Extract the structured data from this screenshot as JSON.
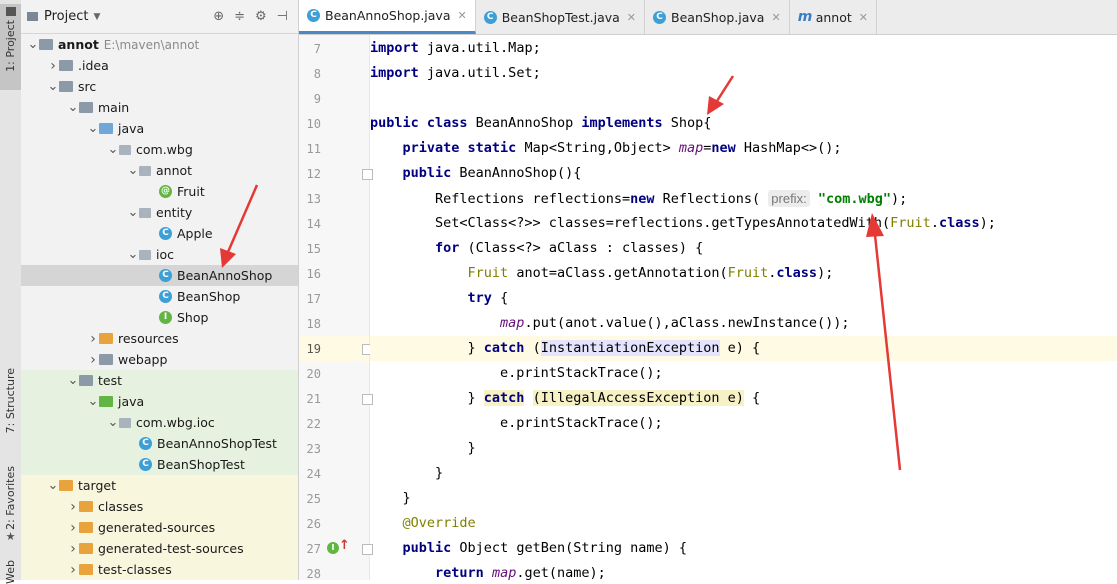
{
  "sidebar_strip": {
    "project_tab": "1: Project",
    "structure_tab": "7: Structure",
    "favorites_tab": "2: Favorites",
    "web_tab": "Web"
  },
  "project_panel": {
    "title": "Project",
    "tree": [
      {
        "label": "annot",
        "note": "E:\\maven\\annot",
        "icon": "module-folder",
        "depth": 0,
        "expanded": true
      },
      {
        "label": ".idea",
        "icon": "folder",
        "depth": 1,
        "expanded": false
      },
      {
        "label": "src",
        "icon": "folder",
        "depth": 1,
        "expanded": true
      },
      {
        "label": "main",
        "icon": "folder",
        "depth": 2,
        "expanded": true
      },
      {
        "label": "java",
        "icon": "source-folder",
        "depth": 3,
        "expanded": true
      },
      {
        "label": "com.wbg",
        "icon": "package",
        "depth": 4,
        "expanded": true
      },
      {
        "label": "annot",
        "icon": "package",
        "depth": 5,
        "expanded": true
      },
      {
        "label": "Fruit",
        "icon": "annotation",
        "depth": 6
      },
      {
        "label": "entity",
        "icon": "package",
        "depth": 5,
        "expanded": true
      },
      {
        "label": "Apple",
        "icon": "class",
        "depth": 6
      },
      {
        "label": "ioc",
        "icon": "package",
        "depth": 5,
        "expanded": true
      },
      {
        "label": "BeanAnnoShop",
        "icon": "class",
        "depth": 6,
        "selected": true
      },
      {
        "label": "BeanShop",
        "icon": "class",
        "depth": 6
      },
      {
        "label": "Shop",
        "icon": "interface",
        "depth": 6
      },
      {
        "label": "resources",
        "icon": "resource-folder",
        "depth": 3,
        "expanded": false
      },
      {
        "label": "webapp",
        "icon": "folder",
        "depth": 3,
        "expanded": false
      },
      {
        "label": "test",
        "icon": "folder",
        "depth": 2,
        "expanded": true
      },
      {
        "label": "java",
        "icon": "test-folder",
        "depth": 3,
        "expanded": true
      },
      {
        "label": "com.wbg.ioc",
        "icon": "package",
        "depth": 4,
        "expanded": true
      },
      {
        "label": "BeanAnnoShopTest",
        "icon": "test-class",
        "depth": 5
      },
      {
        "label": "BeanShopTest",
        "icon": "test-class",
        "depth": 5
      },
      {
        "label": "target",
        "icon": "excluded-folder",
        "depth": 1,
        "expanded": true
      },
      {
        "label": "classes",
        "icon": "excluded-folder",
        "depth": 2,
        "expanded": false
      },
      {
        "label": "generated-sources",
        "icon": "excluded-folder",
        "depth": 2,
        "expanded": false
      },
      {
        "label": "generated-test-sources",
        "icon": "excluded-folder",
        "depth": 2,
        "expanded": false
      },
      {
        "label": "test-classes",
        "icon": "excluded-folder",
        "depth": 2,
        "expanded": false
      }
    ]
  },
  "editor_tabs": [
    {
      "label": "BeanAnnoShop.java",
      "icon": "class",
      "active": true
    },
    {
      "label": "BeanShopTest.java",
      "icon": "test-class",
      "active": false
    },
    {
      "label": "BeanShop.java",
      "icon": "class",
      "active": false
    },
    {
      "label": "annot",
      "icon": "maven",
      "active": false
    }
  ],
  "editor": {
    "line_numbers": [
      "7",
      "8",
      "9",
      "10",
      "11",
      "12",
      "13",
      "14",
      "15",
      "16",
      "17",
      "18",
      "19",
      "20",
      "21",
      "22",
      "23",
      "24",
      "25",
      "26",
      "27",
      "28"
    ],
    "current_line": "19",
    "param_hint": "prefix:",
    "string_literal": "\"com.wbg\""
  },
  "colors": {
    "keyword": "#000080",
    "field": "#660e7a",
    "string": "#008000",
    "annotation": "#808000",
    "current_line_bg": "#fffae3",
    "arrow": "#e53935"
  }
}
